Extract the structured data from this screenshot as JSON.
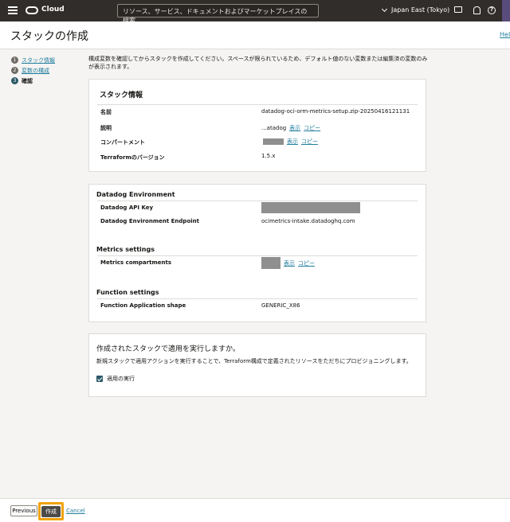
{
  "topbar": {
    "brand": "Cloud",
    "search_placeholder": "リソース、サービス、ドキュメントおよびマーケットプレイスの検索",
    "region": "Japan East (Tokyo)",
    "icons": [
      "menu-icon",
      "oracle-logo",
      "monitor-icon",
      "bell-icon",
      "help-icon"
    ]
  },
  "header": {
    "title": "スタックの作成",
    "help": "Help"
  },
  "steps": [
    {
      "num": "1",
      "label": "スタック情報"
    },
    {
      "num": "2",
      "label": "変数の構成"
    },
    {
      "num": "3",
      "label": "確認"
    }
  ],
  "intro": "構成変数を確認してからスタックを作成してください。スペースが限られているため、デフォルト値のない変数または編集済の変数のみが表示されます。",
  "stack_info": {
    "title": "スタック情報",
    "rows": [
      {
        "label": "名前",
        "value": "datadog-oci-orm-metrics-setup.zip-20250416121131"
      },
      {
        "label": "説明",
        "value": "...atadog",
        "show": "表示",
        "copy": "コピー"
      },
      {
        "label": "コンパートメント",
        "value": "",
        "show": "表示",
        "copy": "コピー"
      },
      {
        "label": "Terraformのバージョン",
        "value": "1.5.x"
      }
    ]
  },
  "variables": {
    "datadog_env": {
      "title": "Datadog Environment",
      "api_key_label": "Datadog API Key",
      "endpoint_label": "Datadog Environment Endpoint",
      "endpoint_value": "ocimetrics-intake.datadoghq.com"
    },
    "metrics": {
      "title": "Metrics settings",
      "compartments_label": "Metrics compartments",
      "show": "表示",
      "copy": "コピー"
    },
    "function": {
      "title": "Function settings",
      "shape_label": "Function Application shape",
      "shape_value": "GENERIC_X86"
    }
  },
  "apply": {
    "question": "作成されたスタックで適用を実行しますか。",
    "description": "新規スタックで適用アクションを実行することで、Terraform構成で定義されたリソースをただちにプロビジョニングします。",
    "checkbox_label": "適用の実行",
    "checked": true
  },
  "footer": {
    "previous": "Previous",
    "create": "作成",
    "cancel": "Cancel"
  },
  "colors": {
    "accent": "#227e9e",
    "highlight": "#f0a30a",
    "topbar": "#312d2a"
  }
}
